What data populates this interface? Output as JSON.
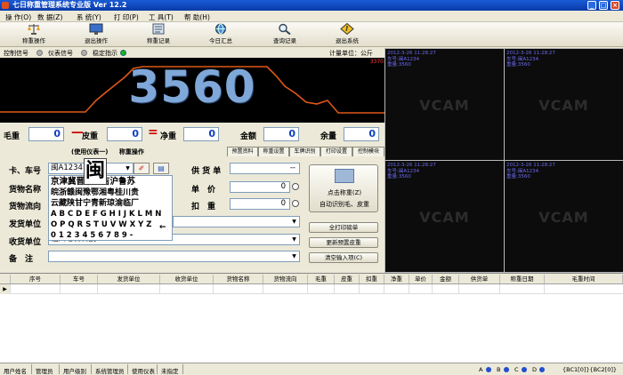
{
  "window": {
    "title": "七日称重管理系统专业版 Ver 12.2",
    "min": "_",
    "max": "□",
    "close": "×"
  },
  "menu": [
    "操 作(O)",
    "数 据(Z)",
    "系 统(Y)",
    "打 印(P)",
    "工 具(T)",
    "帮 助(H)"
  ],
  "toolbar": [
    {
      "label": "称重操作",
      "icon": "scale-icon"
    },
    {
      "label": "退出操作",
      "icon": "monitor-icon"
    },
    {
      "label": "称重记录",
      "icon": "record-icon"
    },
    {
      "label": "今日汇总",
      "icon": "globe-icon"
    },
    {
      "label": "查询记录",
      "icon": "search-icon"
    },
    {
      "label": "退出系统",
      "icon": "exit-icon"
    }
  ],
  "indicators": {
    "control": "控制信号",
    "meter": "仪表信号",
    "stable": "稳定指示",
    "unit_label": "计量单位：公斤",
    "green": "#22b022"
  },
  "display": {
    "value": "3560",
    "side": "3370"
  },
  "weights": {
    "gross_label": "毛重",
    "gross": "0",
    "minus": "—",
    "tare_label": "皮重",
    "tare": "0",
    "equals": "=",
    "net_label": "净重",
    "net": "0",
    "amount_label": "金额",
    "amount": "0",
    "balance_label": "余量",
    "balance": "0"
  },
  "form_header": {
    "source": "(使用仪表一)",
    "mode": "称重操作"
  },
  "tabs": [
    "预置资料",
    "称重设置",
    "车牌识别",
    "打印设置",
    "控制模块"
  ],
  "form": {
    "plate_label": "卡、车号",
    "plate_value": "闽A1234",
    "goods_label": "货物名称",
    "flow_label": "货物流向",
    "sender_label": "发货单位",
    "receiver_label": "收货单位",
    "receiver_value": "福州七日科技",
    "note_label": "备　注",
    "supplier_label": "供 货 单",
    "price_label": "单　价",
    "price_value": "0",
    "deduct_label": "扣　重",
    "deduct_value": "0",
    "supplier_value": "--"
  },
  "plate_picker": {
    "big": "闽",
    "rows": [
      "京津冀晋蒙辽吉沪鲁苏",
      "皖浙赣闽豫鄂湘粤桂川贵",
      "云藏陕甘宁青新琼渝临厂",
      "A B C D E F G H I J K L M N",
      "O P Q R S T U V W X Y Z",
      "0 1 2 3 4 5 6 7 8 9 -"
    ]
  },
  "buttons": {
    "weigh": "点击称重(Z)",
    "auto": "自动识别毛、皮重",
    "print": "全打印磅单",
    "update_tare": "更新预置皮重",
    "clear": "清空输入项(C)"
  },
  "cameras": [
    {
      "meta": "2012-3-26 11:28:27\n车号:闽A1234\n重量:3560"
    },
    {
      "meta": "2012-3-26 11:28:27\n车号:闽A1234\n重量:3560"
    },
    {
      "meta": "2012-3-26 11:28:27\n车号:闽A1234\n重量:3560"
    },
    {
      "meta": "2012-3-26 11:28:27\n车号:闽A1234\n重量:3560"
    }
  ],
  "camera_watermark": "VCAM",
  "grid_columns": [
    "序号",
    "车号",
    "发货单位",
    "收货单位",
    "货物名称",
    "货物流向",
    "毛重",
    "皮重",
    "扣重",
    "净重",
    "单价",
    "金额",
    "供货单",
    "称重日期",
    "毛重时间"
  ],
  "status": {
    "user_name": "用户姓名",
    "admin": "管理员",
    "user_level": "用户级别",
    "sys_admin": "系统管理员",
    "instrument": "使用仪表",
    "unset": "未指定",
    "a": "A",
    "b": "B",
    "c": "C",
    "d": "D",
    "ports": "{BC1[0]}{BC2[0]}"
  }
}
